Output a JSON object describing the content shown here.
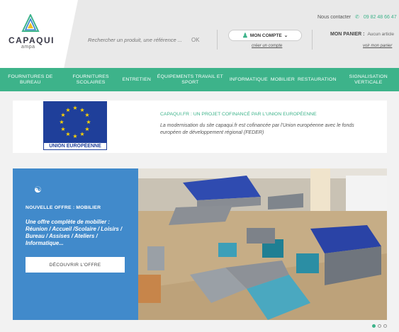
{
  "header": {
    "logo": {
      "name": "CAPAQUI",
      "sub": "ampa"
    },
    "search": {
      "placeholder": "Rechercher un produit, une référence ...",
      "button": "OK"
    },
    "account": {
      "button": "MON COMPTE",
      "create": "créer un compte"
    },
    "contact": {
      "label": "Nous contacter",
      "phone": "09 82 48 66 47"
    },
    "cart": {
      "label": "MON PANIER :",
      "value": "Aucun article",
      "link": "voir mon panier"
    }
  },
  "nav": [
    {
      "label": "FOURNITURES DE BUREAU"
    },
    {
      "label": "FOURNITURES SCOLAIRES"
    },
    {
      "label": "ENTRETIEN"
    },
    {
      "label": "ÉQUIPEMENTS TRAVAIL ET SPORT"
    },
    {
      "label": "INFORMATIQUE"
    },
    {
      "label": "MOBILIER"
    },
    {
      "label": "RESTAURATION"
    },
    {
      "label": "SIGNALISATION VERTICALE"
    }
  ],
  "eu_banner": {
    "flag_label": "UNION EUROPÉENNE",
    "title": "CAPAQUI.FR : UN PROJET COFINANCÉ PAR L'UNION EUROPÉENNE",
    "text": "La modernisation du site capaqui.fr est cofinancée par l'Union européenne avec le fonds européen de développement régional (FEDER)"
  },
  "hero": {
    "kicker": "NOUVELLE OFFRE : MOBILIER",
    "text": "Une offre complète de mobilier : Réunion / Accueil /Scolaire / Loisirs / Bureau / Assises / Ateliers / Informatique...",
    "button": "DÉCOUVRIR L'OFFRE"
  },
  "carousel": {
    "slide_count": 3,
    "active_index": 0
  },
  "colors": {
    "brand_green": "#3db38a",
    "overlay_blue": "#3484cc",
    "eu_blue": "#1f3f9a"
  }
}
